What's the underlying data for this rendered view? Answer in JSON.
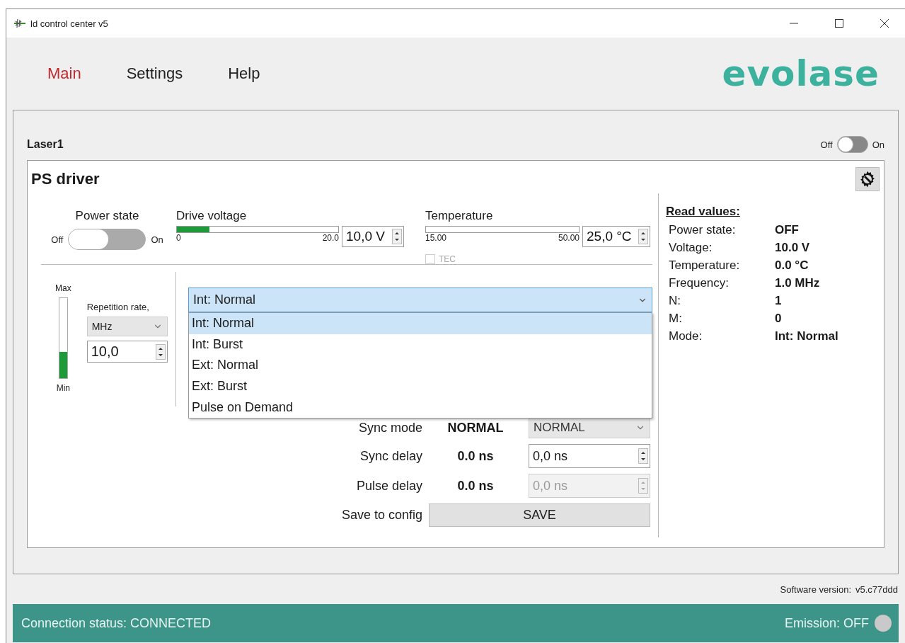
{
  "window": {
    "title": "ld control center v5"
  },
  "nav": [
    {
      "label": "Main",
      "selected": true
    },
    {
      "label": "Settings",
      "selected": false
    },
    {
      "label": "Help",
      "selected": false
    }
  ],
  "logo": "evolase",
  "laser": {
    "name": "Laser1",
    "toggle": {
      "off_label": "Off",
      "on_label": "On",
      "on": false
    }
  },
  "driver": {
    "title": "PS driver",
    "power_state": {
      "label": "Power state",
      "off_label": "Off",
      "on_label": "On",
      "on": false
    },
    "drive_voltage": {
      "label": "Drive voltage",
      "level": 0.2,
      "min": "0",
      "max": "20.0",
      "value": "10,0 V"
    },
    "temperature": {
      "label": "Temperature",
      "level": 0,
      "min": "15.00",
      "max": "50.00",
      "value": "25,0 °C",
      "tec": {
        "label": "TEC",
        "checked": false,
        "disabled": true
      }
    },
    "rate": {
      "max_label": "Max",
      "min_label": "Min",
      "level": 0.33,
      "label": "Repetition rate,",
      "unit": "MHz",
      "value": "10,0"
    },
    "mode": {
      "value": "Int: Normal",
      "expanded": true,
      "options": [
        {
          "label": "Int: Normal",
          "selected": true
        },
        {
          "label": "Int: Burst",
          "selected": false
        },
        {
          "label": "Ext: Normal",
          "selected": false
        },
        {
          "label": "Ext: Burst",
          "selected": false
        },
        {
          "label": "Pulse on Demand",
          "selected": false
        }
      ]
    },
    "settings": [
      {
        "kind": "select",
        "label": "Sync mode",
        "reading": "NORMAL",
        "value": "NORMAL",
        "disabled": false
      },
      {
        "kind": "spin",
        "label": "Sync delay",
        "reading": "0.0 ns",
        "value": "0,0 ns",
        "disabled": false
      },
      {
        "kind": "spin",
        "label": "Pulse delay",
        "reading": "0.0 ns",
        "value": "0,0 ns",
        "disabled": true
      },
      {
        "kind": "button",
        "label": "Save to config",
        "value": "SAVE",
        "disabled": false
      }
    ]
  },
  "read_values": {
    "title": "Read values:",
    "rows": [
      {
        "label": "Power state:",
        "value": "OFF"
      },
      {
        "label": "Voltage:",
        "value": "10.0 V"
      },
      {
        "label": "Temperature:",
        "value": "0.0 °C"
      },
      {
        "label": "Frequency:",
        "value": "1.0 MHz"
      },
      {
        "label": "N:",
        "value": "1"
      },
      {
        "label": "M:",
        "value": "0"
      },
      {
        "label": "Mode:",
        "value": "Int: Normal"
      }
    ]
  },
  "software_version": {
    "label": "Software version:",
    "value": "v5.c77ddd"
  },
  "status_bar": {
    "connection": "Connection status: CONNECTED",
    "emission": "Emission: OFF",
    "emission_on": false
  }
}
